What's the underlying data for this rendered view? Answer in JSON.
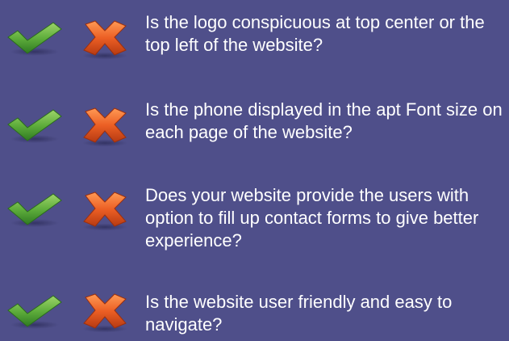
{
  "checklist": {
    "items": [
      {
        "question": "Is the logo conspicuous at top center or the top left of the website?"
      },
      {
        "question": "Is the phone displayed in the apt Font size on each page of the website?"
      },
      {
        "question": "Does your website provide the users with option to fill up contact forms to give better experience?"
      },
      {
        "question": "Is the website user friendly and easy to navigate?"
      }
    ]
  },
  "icons": {
    "check": "checkmark-icon",
    "cross": "cross-icon"
  },
  "colors": {
    "background": "#4f4f8a",
    "check_green": "#5aa33b",
    "cross_orange": "#e8602a",
    "text": "#ffffff"
  }
}
